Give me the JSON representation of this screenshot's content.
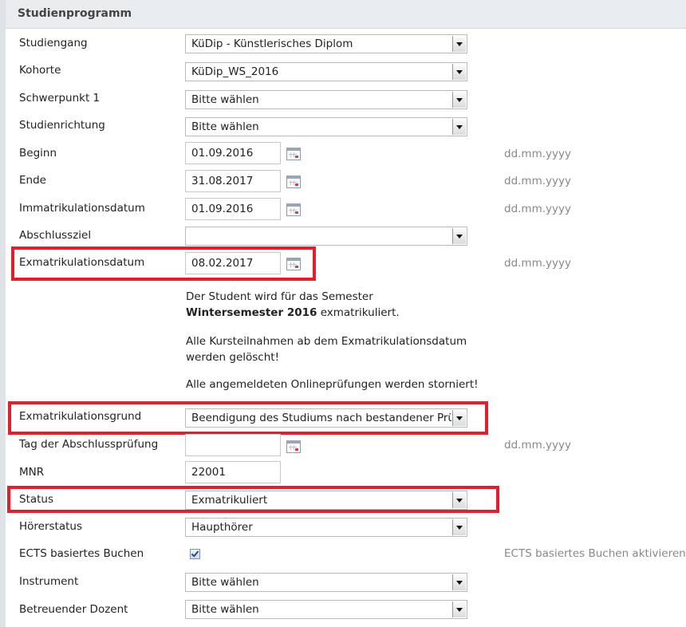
{
  "section_title": "Studienprogramm",
  "fields": {
    "studiengang": {
      "label": "Studiengang",
      "value": "KüDip - Künstlerisches Diplom"
    },
    "kohorte": {
      "label": "Kohorte",
      "value": "KüDip_WS_2016"
    },
    "schwerpunkt": {
      "label": "Schwerpunkt 1",
      "value": "Bitte wählen"
    },
    "studienrichtung": {
      "label": "Studienrichtung",
      "value": "Bitte wählen"
    },
    "beginn": {
      "label": "Beginn",
      "value": "01.09.2016",
      "hint": "dd.mm.yyyy"
    },
    "ende": {
      "label": "Ende",
      "value": "31.08.2017",
      "hint": "dd.mm.yyyy"
    },
    "immatrikulationsdatum": {
      "label": "Immatrikulationsdatum",
      "value": "01.09.2016",
      "hint": "dd.mm.yyyy"
    },
    "abschlussziel": {
      "label": "Abschlussziel",
      "value": ""
    },
    "exmatrikulationsdatum": {
      "label": "Exmatrikulationsdatum",
      "value": "08.02.2017",
      "hint": "dd.mm.yyyy"
    },
    "exmatrikulationsgrund": {
      "label": "Exmatrikulationsgrund",
      "value": "Beendigung des Studiums nach bestandener Prüf"
    },
    "tag_abschlusspruefung": {
      "label": "Tag der Abschlussprüfung",
      "value": "",
      "hint": "dd.mm.yyyy"
    },
    "mnr": {
      "label": "MNR",
      "value": "22001"
    },
    "status": {
      "label": "Status",
      "value": "Exmatrikuliert"
    },
    "hoererstatus": {
      "label": "Hörerstatus",
      "value": "Haupthörer"
    },
    "ects": {
      "label": "ECTS basiertes Buchen",
      "checked": true,
      "hint": "ECTS basiertes Buchen aktivieren"
    },
    "instrument": {
      "label": "Instrument",
      "value": "Bitte wählen"
    },
    "betreuender_dozent": {
      "label": "Betreuender Dozent",
      "value": "Bitte wählen"
    }
  },
  "messages": {
    "semester_pre": "Der Student wird für das Semester",
    "semester_bold": "Wintersemester 2016",
    "semester_post": "exmatrikuliert.",
    "kurs": "Alle Kursteilnahmen ab dem Exmatrikulationsdatum werden gelöscht!",
    "online": "Alle angemeldeten Onlineprüfungen werden storniert!"
  },
  "highlight_color": "#e2202b"
}
